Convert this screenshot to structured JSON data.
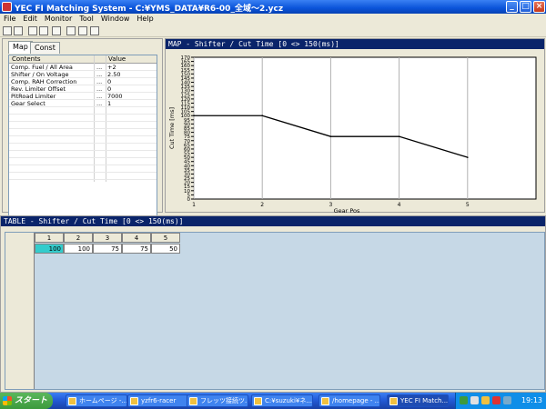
{
  "window": {
    "title": "YEC FI Matching System - C:¥YMS_DATA¥R6-00_全域〜2.ycz",
    "minimize_label": "_",
    "maximize_label": "□",
    "close_label": "×"
  },
  "menu": [
    "File",
    "Edit",
    "Monitor",
    "Tool",
    "Window",
    "Help"
  ],
  "left_panel": {
    "tabs": [
      "Map",
      "Const"
    ],
    "columns": [
      "Contents",
      "Value"
    ],
    "rows": [
      {
        "name": "Comp. Fuel / All Area",
        "mark": "...",
        "value": "+2"
      },
      {
        "name": "Shifter / On Voltage",
        "mark": "...",
        "value": "2.50"
      },
      {
        "name": "Comp. RAH Correction",
        "mark": "...",
        "value": "0"
      },
      {
        "name": "Rev. Limiter Offset",
        "mark": "...",
        "value": "0"
      },
      {
        "name": "PitRoad Limiter",
        "mark": "...",
        "value": "7000"
      },
      {
        "name": "Gear Select",
        "mark": "...",
        "value": "1"
      }
    ],
    "nav_buttons": [
      "⮇",
      "⌄",
      "⌃",
      "⮅"
    ]
  },
  "graph_panel": {
    "header": "MAP - Shifter / Cut Time    [0 <> 150(ms)]"
  },
  "chart_data": {
    "type": "line",
    "title": "",
    "xlabel": "Gear Pos",
    "ylabel": "Cut Time [ms]",
    "x": [
      1,
      2,
      3,
      4,
      5
    ],
    "y": [
      100,
      100,
      75,
      75,
      50
    ],
    "xlim": [
      1,
      6
    ],
    "ylim": [
      0,
      170
    ],
    "yticks": [
      0,
      5,
      10,
      15,
      20,
      25,
      30,
      35,
      40,
      45,
      50,
      55,
      60,
      65,
      70,
      75,
      80,
      85,
      90,
      95,
      100,
      105,
      110,
      115,
      120,
      125,
      130,
      135,
      140,
      145,
      150,
      155,
      160,
      165,
      170
    ],
    "xticks": [
      1,
      2,
      3,
      4,
      5
    ],
    "grid": "vertical",
    "line_color": "#000000"
  },
  "table_panel": {
    "header": "TABLE - Shifter / Cut Time    [0 <> 150(ms)]",
    "columns": [
      "1",
      "2",
      "3",
      "4",
      "5"
    ],
    "values": [
      "100",
      "100",
      "75",
      "75",
      "50"
    ],
    "selected_index": 0
  },
  "taskbar": {
    "start_label": "スタート",
    "tasks": [
      {
        "label": "ホームページ -..."
      },
      {
        "label": "yzfr6-racer"
      },
      {
        "label": "フレッツ接続ツ..."
      },
      {
        "label": "C:¥suzuki¥ネ..."
      },
      {
        "label": "/homepage - ..."
      },
      {
        "label": "YEC FI Match..."
      }
    ],
    "clock": "19:13"
  },
  "colors": {
    "title_bar": "#0a53d9",
    "panel_header": "#0a246a",
    "table_bg": "#c6d8e6",
    "selected_cell": "#33cccc"
  }
}
